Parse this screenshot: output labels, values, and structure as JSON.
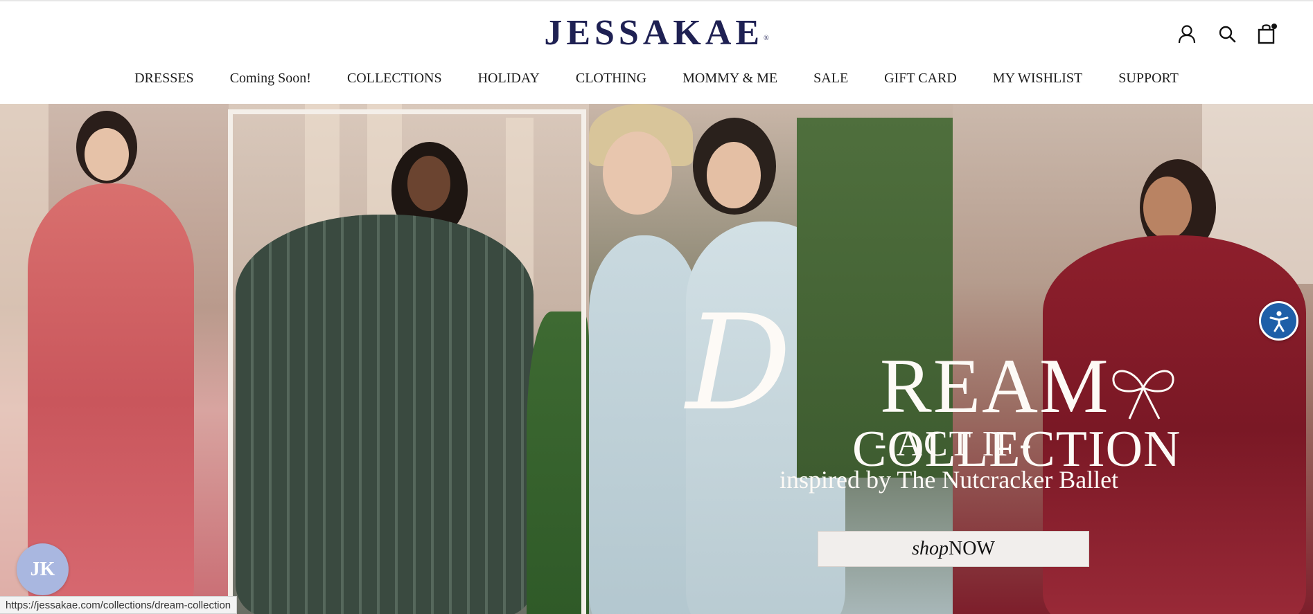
{
  "brand": {
    "logo_text": "JESSAKAE",
    "logo_mark": "®"
  },
  "header_icons": [
    {
      "name": "account-icon"
    },
    {
      "name": "search-icon"
    },
    {
      "name": "cart-icon"
    }
  ],
  "nav": {
    "items": [
      {
        "label": "DRESSES"
      },
      {
        "label": "Coming Soon!"
      },
      {
        "label": "COLLECTIONS"
      },
      {
        "label": "HOLIDAY"
      },
      {
        "label": "CLOTHING"
      },
      {
        "label": "MOMMY & ME"
      },
      {
        "label": "SALE"
      },
      {
        "label": "GIFT CARD"
      },
      {
        "label": "MY WISHLIST"
      },
      {
        "label": "SUPPORT"
      }
    ]
  },
  "hero": {
    "title_initial": "D",
    "title_rest": "REAM",
    "subtitle": "COLLECTION",
    "act": "- ACT II -",
    "tagline": "inspired by The Nutcracker Ballet",
    "cta_italic": "shop",
    "cta_bold": "NOW"
  },
  "badge": {
    "text": "JK"
  },
  "status_bar": {
    "url": "https://jessakae.com/collections/dream-collection"
  },
  "colors": {
    "brand_navy": "#1f2153",
    "a11y_blue": "#1e5fa8",
    "badge_blue": "#a9b7e0"
  }
}
